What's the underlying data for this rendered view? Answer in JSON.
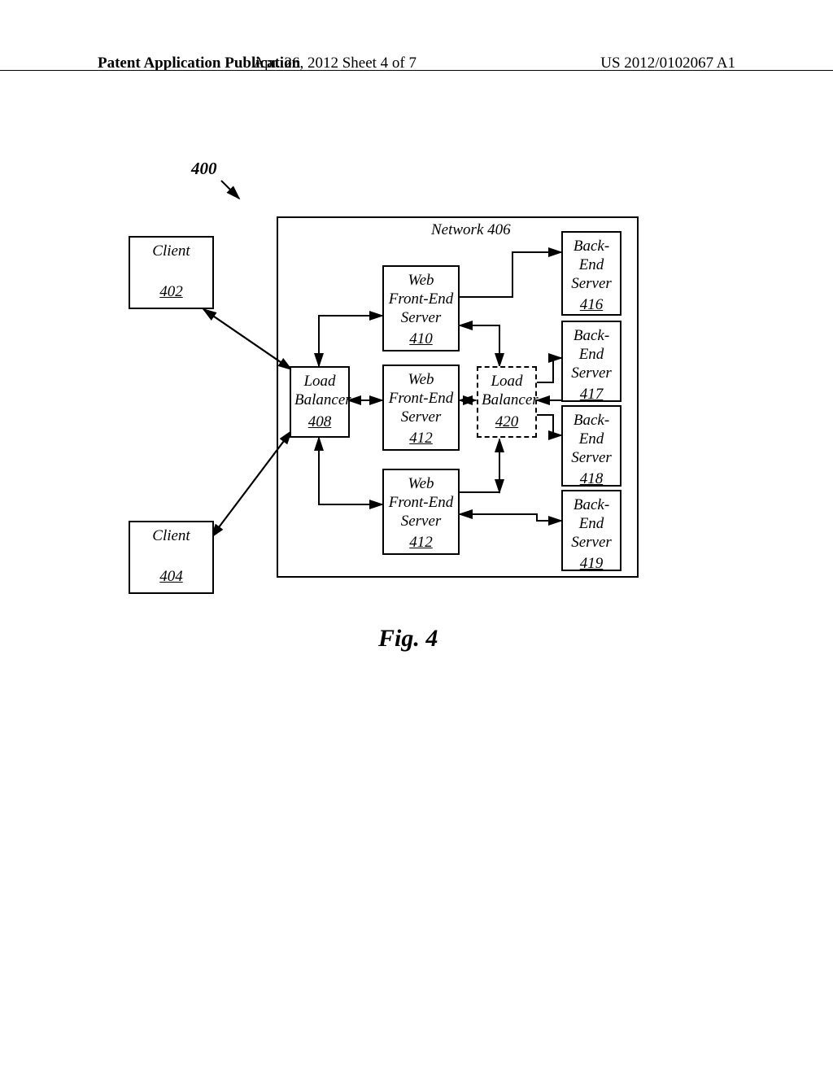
{
  "header": {
    "left": "Patent Application Publication",
    "mid": "Apr. 26, 2012  Sheet 4 of 7",
    "right": "US 2012/0102067 A1"
  },
  "figure": {
    "ref_label": "400",
    "caption": "Fig. 4",
    "network_title": "Network 406",
    "boxes": {
      "client1": {
        "label": "Client",
        "num": "402"
      },
      "client2": {
        "label": "Client",
        "num": "404"
      },
      "lb1": {
        "label": "Load\nBalancer",
        "num": "408"
      },
      "wfe1": {
        "label": "Web\nFront-End\nServer",
        "num": "410"
      },
      "wfe2": {
        "label": "Web\nFront-End\nServer",
        "num": "412"
      },
      "wfe3": {
        "label": "Web\nFront-End\nServer",
        "num": "412"
      },
      "lb2": {
        "label": "Load\nBalancer",
        "num": "420"
      },
      "be1": {
        "label": "Back-\nEnd\nServer",
        "num": "416"
      },
      "be2": {
        "label": "Back-\nEnd\nServer",
        "num": "417"
      },
      "be3": {
        "label": "Back-\nEnd\nServer",
        "num": "418"
      },
      "be4": {
        "label": "Back-\nEnd\nServer",
        "num": "419"
      }
    }
  }
}
